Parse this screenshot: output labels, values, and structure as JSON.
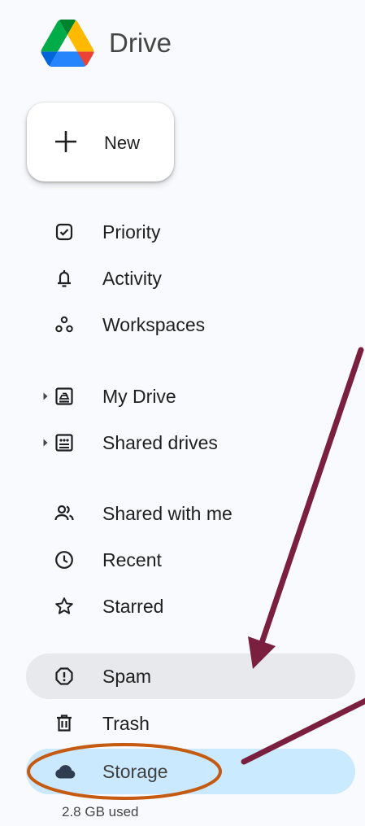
{
  "app": {
    "title": "Drive"
  },
  "new_button": {
    "label": "New"
  },
  "nav": {
    "priority": "Priority",
    "activity": "Activity",
    "workspaces": "Workspaces",
    "my_drive": "My Drive",
    "shared_drives": "Shared drives",
    "shared_with_me": "Shared with me",
    "recent": "Recent",
    "starred": "Starred",
    "spam": "Spam",
    "trash": "Trash",
    "storage": "Storage"
  },
  "storage": {
    "used": "2.8 GB used"
  },
  "icons": {
    "logo": "google-drive-logo",
    "new": "plus-icon",
    "priority": "checkbox-icon",
    "activity": "bell-icon",
    "workspaces": "workspaces-icon",
    "my_drive": "my-drive-icon",
    "shared_drives": "shared-drives-icon",
    "shared_with_me": "people-icon",
    "recent": "clock-icon",
    "starred": "star-icon",
    "spam": "spam-icon",
    "trash": "trash-icon",
    "storage": "cloud-icon"
  },
  "colors": {
    "background": "#f8fafd",
    "selected": "#c2e7ff",
    "hover": "#e8e9ec",
    "annotation_arrow": "#7a1f3d",
    "annotation_circle": "#c55a11"
  }
}
